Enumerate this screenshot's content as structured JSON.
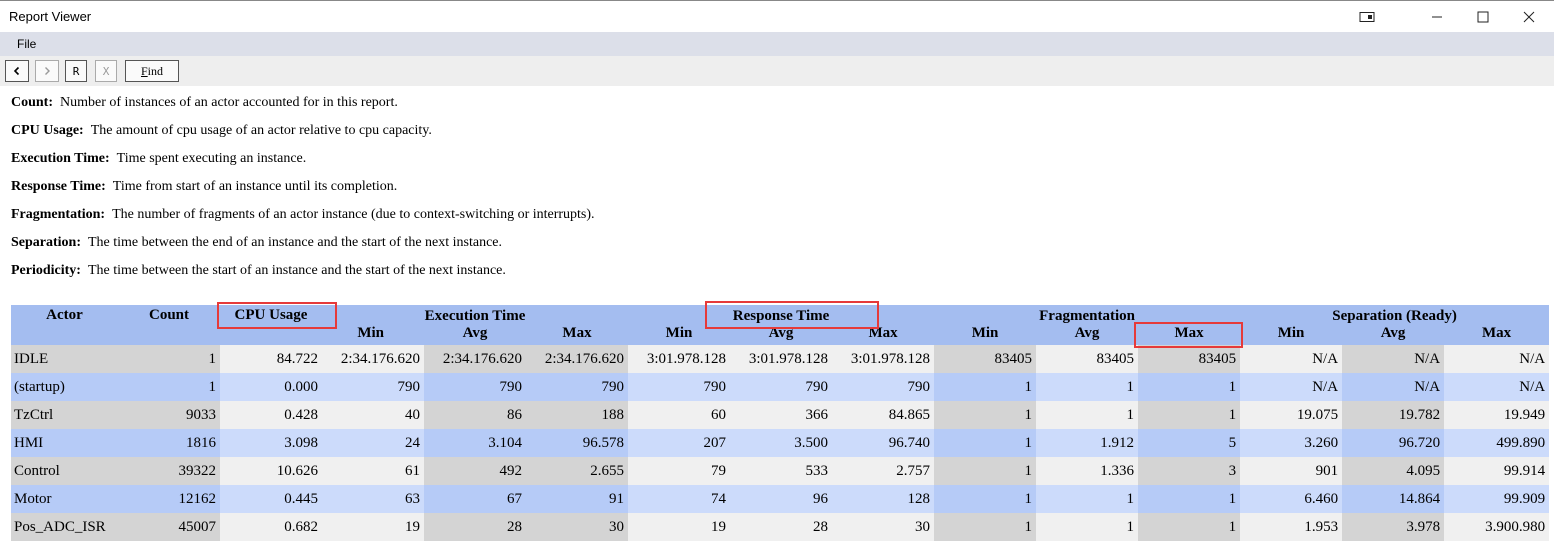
{
  "window": {
    "title": "Report Viewer"
  },
  "menu": {
    "file": "File"
  },
  "toolbar": {
    "back": "<",
    "forward": ">",
    "r": "R",
    "x": "X",
    "find_first": "F",
    "find_rest": "ind"
  },
  "legend": [
    {
      "term": "Count:",
      "desc": "Number of instances of an actor accounted for in this report."
    },
    {
      "term": "CPU Usage:",
      "desc": "The amount of cpu usage of an actor relative to cpu capacity."
    },
    {
      "term": "Execution Time:",
      "desc": "Time spent executing an instance."
    },
    {
      "term": "Response Time:",
      "desc": "Time from start of an instance until its completion."
    },
    {
      "term": "Fragmentation:",
      "desc": "The number of fragments of an actor instance (due to context-switching or interrupts)."
    },
    {
      "term": "Separation:",
      "desc": "The time between the end of an instance and the start of the next instance."
    },
    {
      "term": "Periodicity:",
      "desc": "The time between the start of an instance and the start of the next instance."
    }
  ],
  "table": {
    "groups": {
      "actor": "Actor",
      "count": "Count",
      "cpu": "CPU Usage",
      "exec": "Execution Time",
      "resp": "Response Time",
      "frag": "Fragmentation",
      "sep": "Separation (Ready)"
    },
    "sub": {
      "min": "Min",
      "avg": "Avg",
      "max": "Max"
    },
    "rows": [
      [
        "IDLE",
        "1",
        "84.722",
        "2:34.176.620",
        "2:34.176.620",
        "2:34.176.620",
        "3:01.978.128",
        "3:01.978.128",
        "3:01.978.128",
        "83405",
        "83405",
        "83405",
        "N/A",
        "N/A",
        "N/A"
      ],
      [
        "(startup)",
        "1",
        "0.000",
        "790",
        "790",
        "790",
        "790",
        "790",
        "790",
        "1",
        "1",
        "1",
        "N/A",
        "N/A",
        "N/A"
      ],
      [
        "TzCtrl",
        "9033",
        "0.428",
        "40",
        "86",
        "188",
        "60",
        "366",
        "84.865",
        "1",
        "1",
        "1",
        "19.075",
        "19.782",
        "19.949"
      ],
      [
        "HMI",
        "1816",
        "3.098",
        "24",
        "3.104",
        "96.578",
        "207",
        "3.500",
        "96.740",
        "1",
        "1.912",
        "5",
        "3.260",
        "96.720",
        "499.890"
      ],
      [
        "Control",
        "39322",
        "10.626",
        "61",
        "492",
        "2.655",
        "79",
        "533",
        "2.757",
        "1",
        "1.336",
        "3",
        "901",
        "4.095",
        "99.914"
      ],
      [
        "Motor",
        "12162",
        "0.445",
        "63",
        "67",
        "91",
        "74",
        "96",
        "128",
        "1",
        "1",
        "1",
        "6.460",
        "14.864",
        "99.909"
      ],
      [
        "Pos_ADC_ISR",
        "45007",
        "0.682",
        "19",
        "28",
        "30",
        "19",
        "28",
        "30",
        "1",
        "1",
        "1",
        "1.953",
        "3.978",
        "3.900.980"
      ]
    ]
  }
}
